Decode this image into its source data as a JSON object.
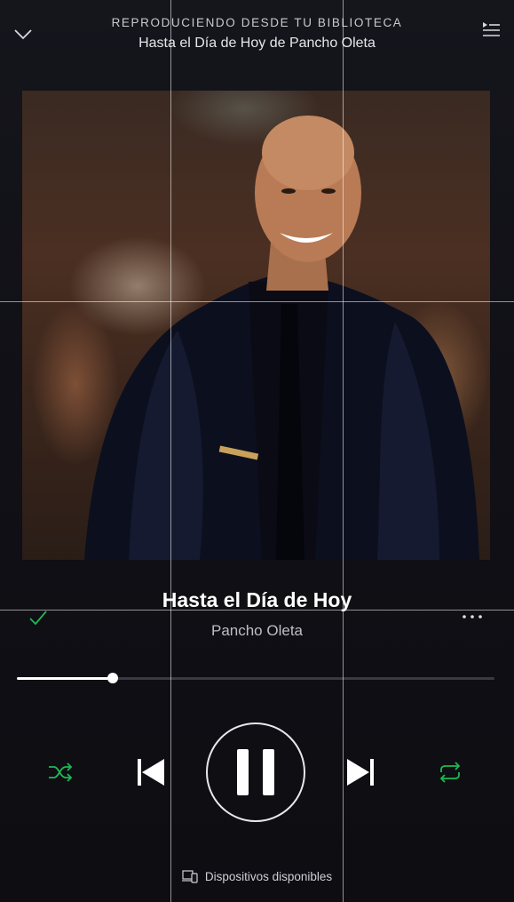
{
  "header": {
    "context_label": "REPRODUCIENDO DESDE TU BIBLIOTECA",
    "context_title": "Hasta el Día de Hoy de Pancho Oleta",
    "collapse_icon": "chevron-down-icon",
    "queue_icon": "queue-list-icon"
  },
  "track": {
    "title": "Hasta el Día de Hoy",
    "artist": "Pancho Oleta",
    "liked": true,
    "progress": 0.2
  },
  "controls": {
    "shuffle_icon": "shuffle-icon",
    "prev_icon": "skip-previous-icon",
    "pause_icon": "pause-icon",
    "next_icon": "skip-next-icon",
    "repeat_icon": "repeat-icon",
    "state": "playing"
  },
  "footer": {
    "devices_label": "Dispositivos disponibles",
    "devices_icon": "devices-icon"
  },
  "colors": {
    "accent": "#1db954",
    "background": "#121218",
    "progress_fill": "#ffffff",
    "progress_track": "#3a3a42"
  }
}
